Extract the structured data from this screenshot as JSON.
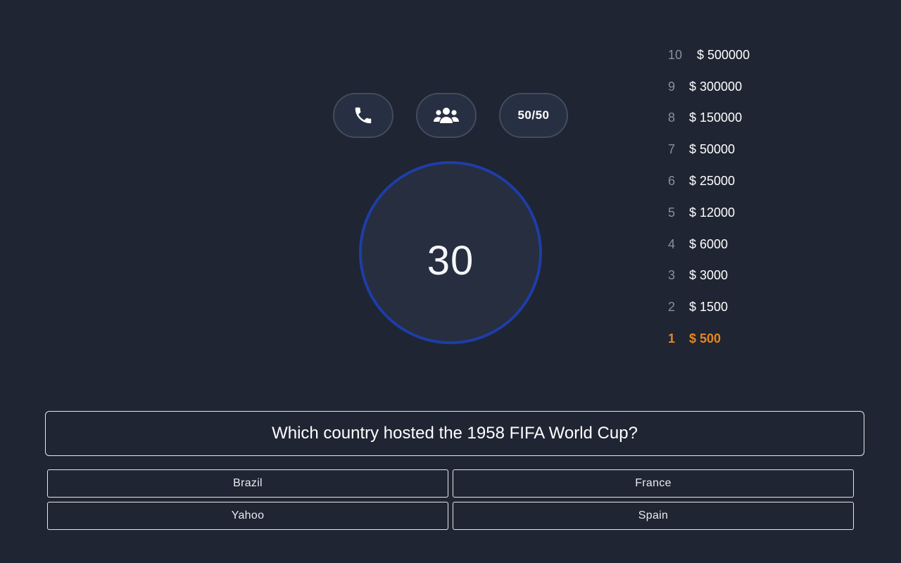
{
  "lifelines": {
    "phone_icon": "phone-icon",
    "audience_icon": "audience-icon",
    "fifty_label": "50/50"
  },
  "timer": {
    "value": "30"
  },
  "ladder": [
    {
      "level": "10",
      "prize": "$ 500000"
    },
    {
      "level": "9",
      "prize": "$ 300000"
    },
    {
      "level": "8",
      "prize": "$ 150000"
    },
    {
      "level": "7",
      "prize": "$ 50000"
    },
    {
      "level": "6",
      "prize": "$ 25000"
    },
    {
      "level": "5",
      "prize": "$ 12000"
    },
    {
      "level": "4",
      "prize": "$ 6000"
    },
    {
      "level": "3",
      "prize": "$ 3000"
    },
    {
      "level": "2",
      "prize": "$ 1500"
    },
    {
      "level": "1",
      "prize": "$ 500"
    }
  ],
  "question": {
    "text": "Which country hosted the 1958 FIFA World Cup?"
  },
  "answers": [
    "Brazil",
    "France",
    "Yahoo",
    "Spain"
  ],
  "colors": {
    "background": "#1f2532",
    "timer_ring": "#1e3da6",
    "current_level": "#e5871e"
  }
}
